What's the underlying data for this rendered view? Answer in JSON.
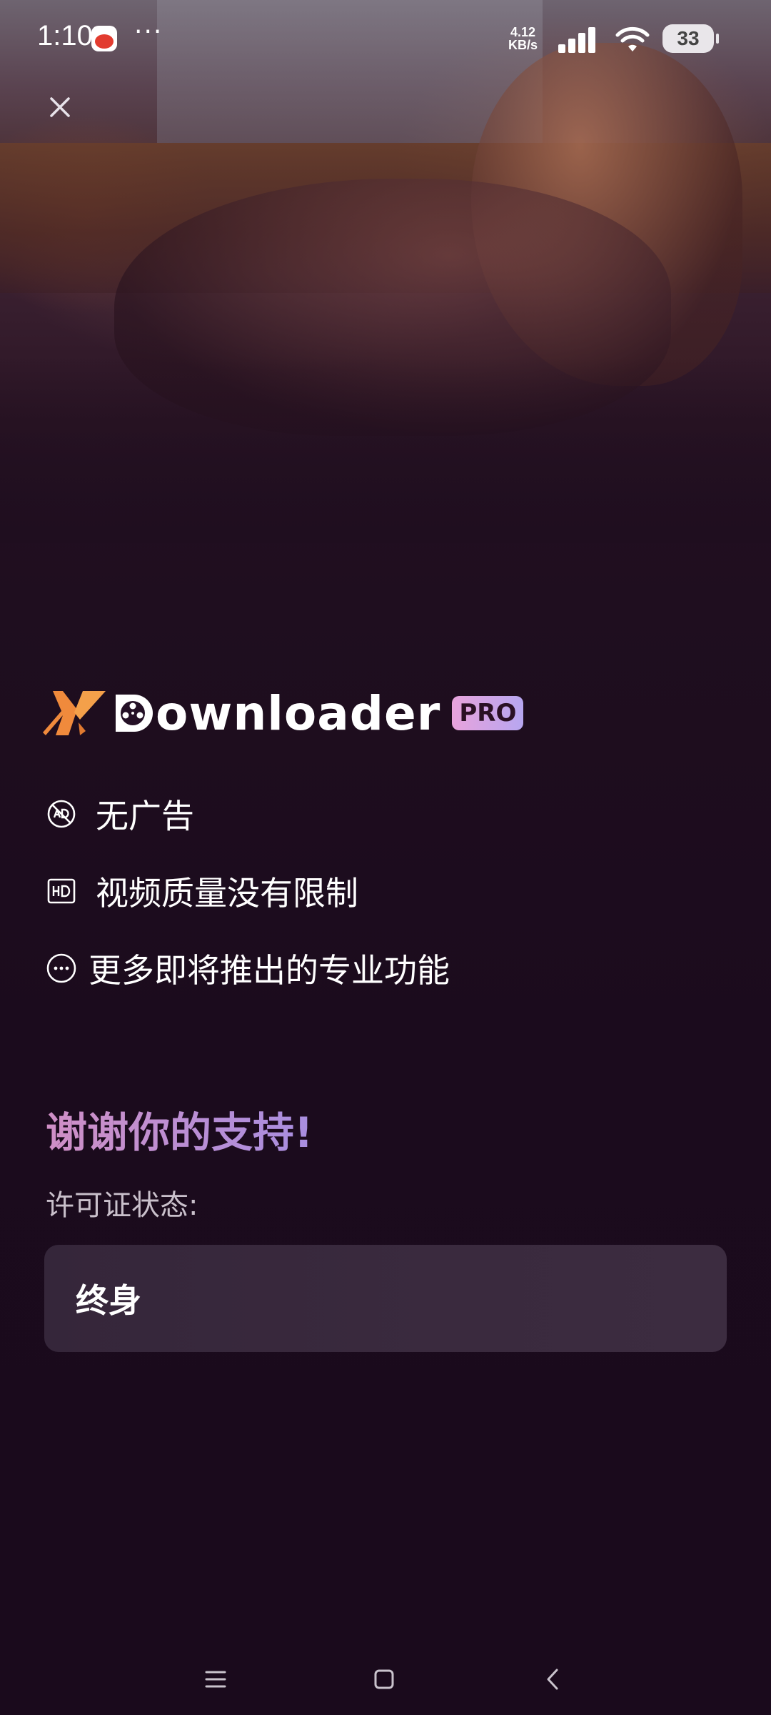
{
  "status_bar": {
    "time": "1:10",
    "overflow_dots": "···",
    "net_speed_value": "4.12",
    "net_speed_unit": "KB/s",
    "battery": "33",
    "icons": [
      "red-envelope-app-icon",
      "signal-icon",
      "wifi-icon",
      "battery-icon"
    ]
  },
  "close_button": {
    "icon": "close-icon"
  },
  "brand": {
    "name_rest": "ownloader",
    "badge": "PRO",
    "accent_color": "#f08a3c"
  },
  "features": [
    {
      "icon": "no-ads-icon",
      "label": "无广告"
    },
    {
      "icon": "hd-icon",
      "label": "视频质量没有限制"
    },
    {
      "icon": "more-icon",
      "label": "更多即将推出的专业功能"
    }
  ],
  "thanks": {
    "title": "谢谢你的支持!",
    "license_label": "许可证状态:",
    "license_value": "终身"
  },
  "nav_bar": {
    "buttons": [
      "menu-icon",
      "home-icon",
      "back-icon"
    ]
  }
}
